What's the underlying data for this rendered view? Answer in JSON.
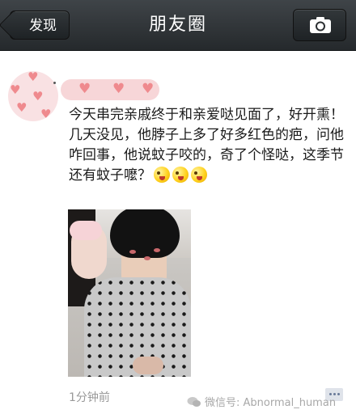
{
  "nav": {
    "back_label": "发现",
    "title": "朋友圈",
    "camera_icon": "camera-icon"
  },
  "post": {
    "text": "今天串完亲戚终于和亲爱哒见面了，好开熏！几天没见，他脖子上多了好多红色的疤，问他咋回事，他说蚊子咬的，奇了个怪哒，这季节还有蚊子嚒？",
    "emoji_icon": "wink-tongue-emoji-icon",
    "emoji_count": 3,
    "timestamp": "1分钟前"
  },
  "watermark": {
    "text": "微信号: Abnormal_human"
  },
  "colors": {
    "navbar": "#2c3033",
    "avatar_pink": "#f9e1e3",
    "heart": "#ef8a8e",
    "timestamp": "#999999"
  }
}
